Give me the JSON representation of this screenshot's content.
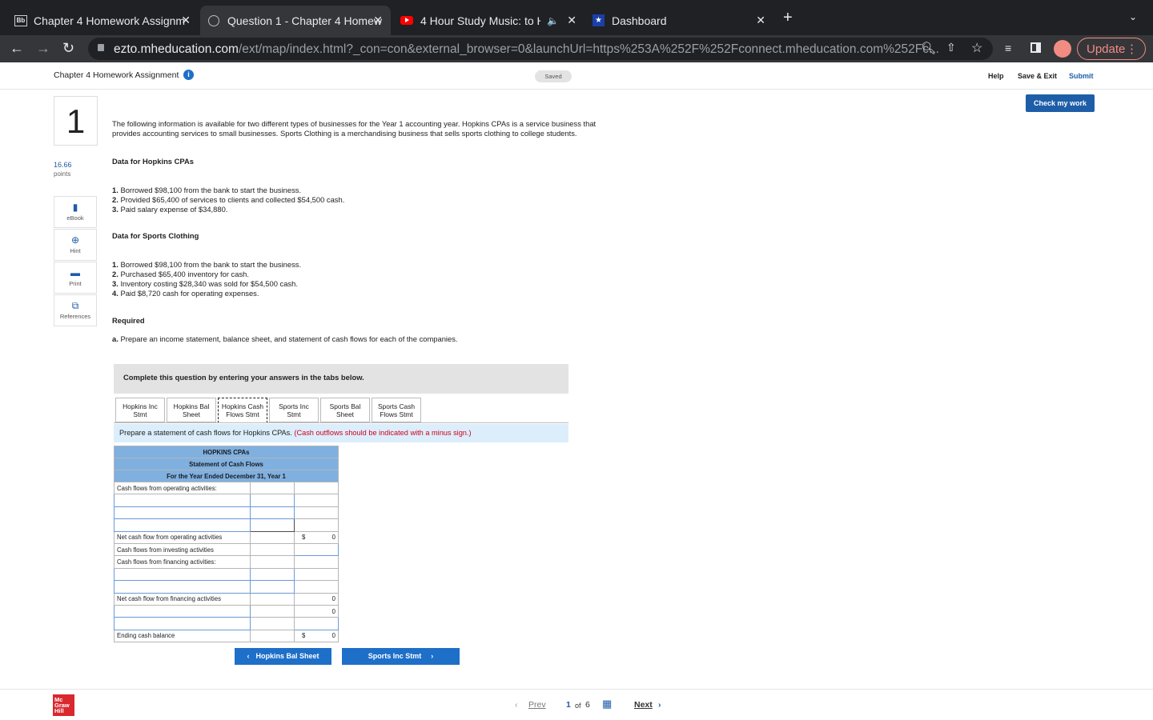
{
  "browser": {
    "tabs": [
      "Chapter 4 Homework Assignm",
      "Question 1 - Chapter 4 Homew",
      "4 Hour Study Music: to Hel",
      "Dashboard"
    ],
    "url_host": "ezto.mheducation.com",
    "url_path": "/ext/map/index.html?_con=con&external_browser=0&launchUrl=https%253A%252F%252Fconnect.mheducation.com%252Fc...",
    "update_label": "Update"
  },
  "app": {
    "title": "Chapter 4 Homework Assignment",
    "saved": "Saved",
    "help": "Help",
    "save_exit": "Save & Exit",
    "submit": "Submit",
    "check": "Check my work"
  },
  "question": {
    "number": "1",
    "points": "16.66",
    "points_label": "points",
    "side": [
      "eBook",
      "Hint",
      "Print",
      "References"
    ],
    "intro": "The following information is available for two different types of businesses for the Year 1 accounting year. Hopkins CPAs is a service business that provides accounting services to small businesses. Sports Clothing is a merchandising business that sells sports clothing to college students.",
    "hopkins_head": "Data for Hopkins CPAs",
    "hopkins": [
      [
        "1.",
        "Borrowed $98,100 from the bank to start the business."
      ],
      [
        "2.",
        "Provided $65,400 of services to clients and collected $54,500 cash."
      ],
      [
        "3.",
        "Paid salary expense of $34,880."
      ]
    ],
    "sports_head": "Data for Sports Clothing",
    "sports": [
      [
        "1.",
        "Borrowed $98,100 from the bank to start the business."
      ],
      [
        "2.",
        "Purchased $65,400 inventory for cash."
      ],
      [
        "3.",
        "Inventory costing $28,340 was sold for $54,500 cash."
      ],
      [
        "4.",
        "Paid $8,720 cash for operating expenses."
      ]
    ],
    "required_head": "Required",
    "required_a": [
      "a.",
      "Prepare an income statement, balance sheet, and statement of cash flows for each of the companies."
    ],
    "complete": "Complete this question by entering your answers in the tabs below.",
    "tabs": [
      [
        "Hopkins Inc",
        "Stmt"
      ],
      [
        "Hopkins Bal",
        "Sheet"
      ],
      [
        "Hopkins Cash",
        "Flows Stmt"
      ],
      [
        "Sports Inc",
        "Stmt"
      ],
      [
        "Sports Bal",
        "Sheet"
      ],
      [
        "Sports Cash",
        "Flows Stmt"
      ]
    ],
    "instr": "Prepare a statement of cash flows for Hopkins CPAs.",
    "instr_red": "(Cash outflows should be indicated with a minus sign.)"
  },
  "statement": {
    "h1": "HOPKINS CPAs",
    "h2": "Statement of Cash Flows",
    "h3": "For the Year Ended December 31, Year 1",
    "op_head": "Cash flows from operating activities:",
    "net_op": "Net cash flow from operating activities",
    "net_op_sym": "$",
    "net_op_val": "0",
    "inv_head": "Cash flows from investing activities",
    "fin_head": "Cash flows from financing activities:",
    "net_fin": "Net cash flow from financing activities",
    "net_fin_val": "0",
    "row_val": "0",
    "end": "Ending cash balance",
    "end_sym": "$",
    "end_val": "0"
  },
  "nav": {
    "prev_tab": "Hopkins Bal Sheet",
    "next_tab": "Sports Inc Stmt",
    "prev": "Prev",
    "page": "1",
    "of": "of",
    "total": "6",
    "next": "Next"
  },
  "logo": [
    "Mc",
    "Graw",
    "Hill"
  ]
}
